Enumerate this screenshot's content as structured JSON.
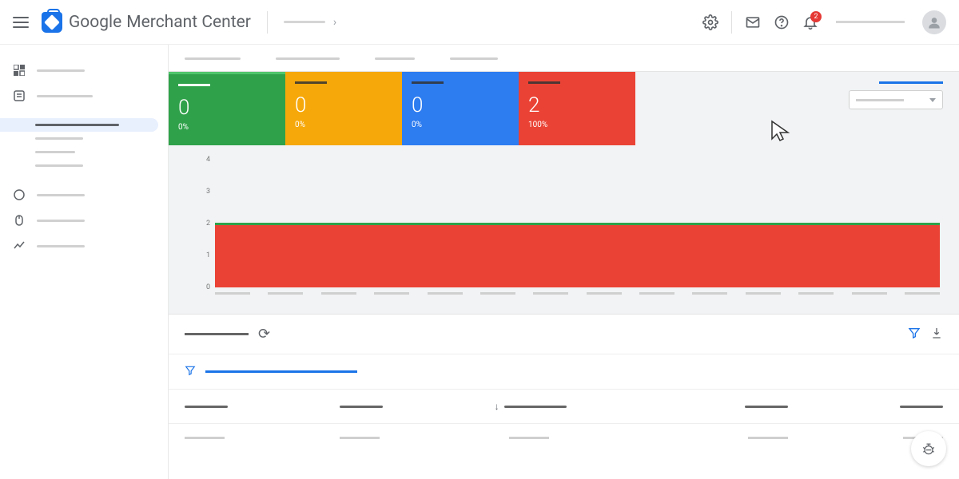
{
  "header": {
    "logo_brand": "Google",
    "logo_product": "Merchant Center",
    "notification_count": "2"
  },
  "cards": [
    {
      "value": "0",
      "percent": "0%"
    },
    {
      "value": "0",
      "percent": "0%"
    },
    {
      "value": "0",
      "percent": "0%"
    },
    {
      "value": "2",
      "percent": "100%"
    }
  ],
  "chart_data": {
    "type": "area",
    "y_ticks": [
      "4",
      "3",
      "2",
      "1",
      "0"
    ],
    "ylim": [
      0,
      4
    ],
    "series": [
      {
        "name": "red",
        "constant_value": 2
      },
      {
        "name": "green",
        "constant_value": 2
      }
    ],
    "x_tick_count": 14
  }
}
